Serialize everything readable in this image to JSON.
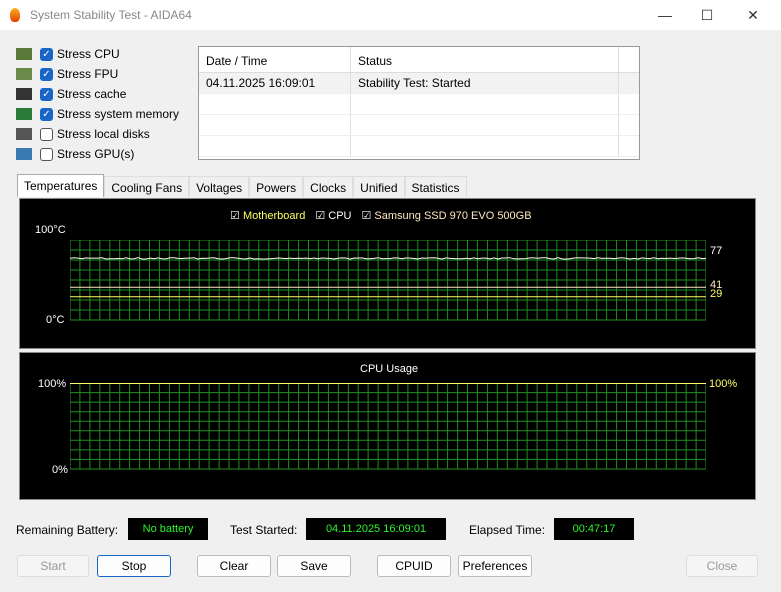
{
  "window": {
    "title": "System Stability Test - AIDA64",
    "minimize": "—",
    "maximize": "☐",
    "close": "✕"
  },
  "options": [
    {
      "label": "Stress CPU",
      "checked": true,
      "icon": "cpu-icon"
    },
    {
      "label": "Stress FPU",
      "checked": true,
      "icon": "fpu-icon"
    },
    {
      "label": "Stress cache",
      "checked": true,
      "icon": "cache-icon"
    },
    {
      "label": "Stress system memory",
      "checked": true,
      "icon": "memory-icon"
    },
    {
      "label": "Stress local disks",
      "checked": false,
      "icon": "disk-icon"
    },
    {
      "label": "Stress GPU(s)",
      "checked": false,
      "icon": "gpu-icon"
    }
  ],
  "log": {
    "headers": [
      "Date / Time",
      "Status"
    ],
    "rows": [
      [
        "04.11.2025 16:09:01",
        "Stability Test: Started"
      ]
    ]
  },
  "tabs": [
    "Temperatures",
    "Cooling Fans",
    "Voltages",
    "Powers",
    "Clocks",
    "Unified",
    "Statistics"
  ],
  "temp_chart": {
    "legend": [
      "Motherboard",
      "CPU",
      "Samsung SSD 970 EVO 500GB"
    ],
    "ymax": "100°C",
    "ymin": "0°C",
    "values": {
      "cpu": "77",
      "ssd": "41",
      "motherboard": "29"
    }
  },
  "cpu_chart": {
    "title": "CPU Usage",
    "ymax": "100%",
    "ymin": "0%",
    "value": "100%"
  },
  "colors": {
    "grid": "#1f8f1f",
    "motherboard": "#ffff66",
    "cpu": "#ffffff",
    "ssd": "#ffe8c0",
    "value_green": "#2cf52c"
  },
  "status": {
    "battery_label": "Remaining Battery:",
    "battery_value": "No battery",
    "started_label": "Test Started:",
    "started_value": "04.11.2025 16:09:01",
    "elapsed_label": "Elapsed Time:",
    "elapsed_value": "00:47:17"
  },
  "buttons": {
    "start": "Start",
    "stop": "Stop",
    "clear": "Clear",
    "save": "Save",
    "cpuid": "CPUID",
    "preferences": "Preferences",
    "close": "Close"
  }
}
